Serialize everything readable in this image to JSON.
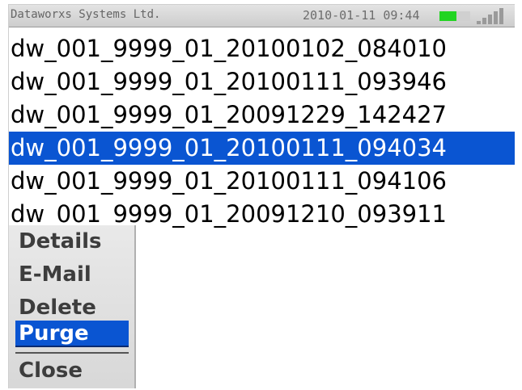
{
  "status": {
    "company": "Dataworxs Systems Ltd.",
    "datetime": "2010-01-11 09:44",
    "battery_level": 0.55,
    "battery_color": "#22d422",
    "signal_icon": "signal-bars-icon"
  },
  "files": [
    {
      "name": "dw_001_9999_01_20100102_084010",
      "selected": false
    },
    {
      "name": "dw_001_9999_01_20100111_093946",
      "selected": false
    },
    {
      "name": "dw_001_9999_01_20091229_142427",
      "selected": false
    },
    {
      "name": "dw_001_9999_01_20100111_094034",
      "selected": true
    },
    {
      "name": "dw_001_9999_01_20100111_094106",
      "selected": false
    },
    {
      "name": "dw_001_9999_01_20091210_093911",
      "selected": false
    }
  ],
  "context_menu": {
    "items": [
      "Details",
      "E-Mail",
      "Delete",
      "Purge",
      "Close"
    ],
    "selected": "Purge"
  },
  "colors": {
    "selection": "#0a55d2",
    "text": "#000000"
  }
}
